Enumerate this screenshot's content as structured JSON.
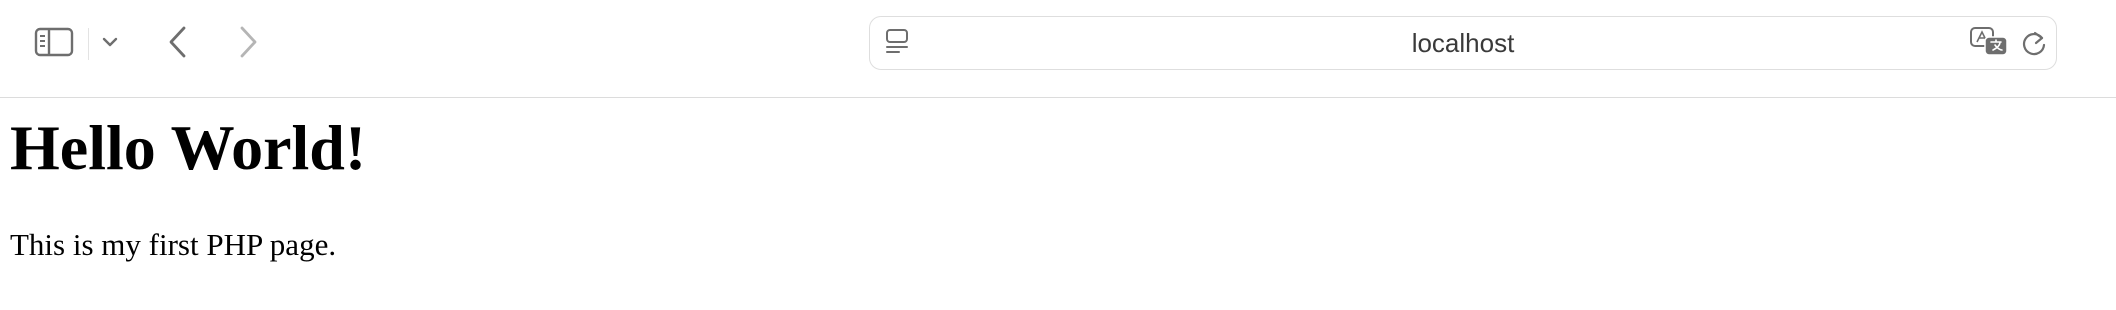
{
  "browser": {
    "toolbar": {
      "icons": {
        "sidebar": "sidebar-toggle-icon",
        "tabs_menu": "chevron-down-icon",
        "back": "chevron-left-icon",
        "forward": "chevron-right-icon",
        "reader": "reader-view-icon",
        "translate": "translate-icon",
        "reload": "reload-icon"
      },
      "forward_enabled": false
    },
    "address_bar": {
      "text": "localhost"
    }
  },
  "page": {
    "heading": "Hello World!",
    "paragraph": "This is my first PHP page."
  },
  "colors": {
    "icon": "#6e6e6e",
    "icon_disabled": "#b5b5b5",
    "border": "#dcdcdc",
    "text": "#000000"
  }
}
